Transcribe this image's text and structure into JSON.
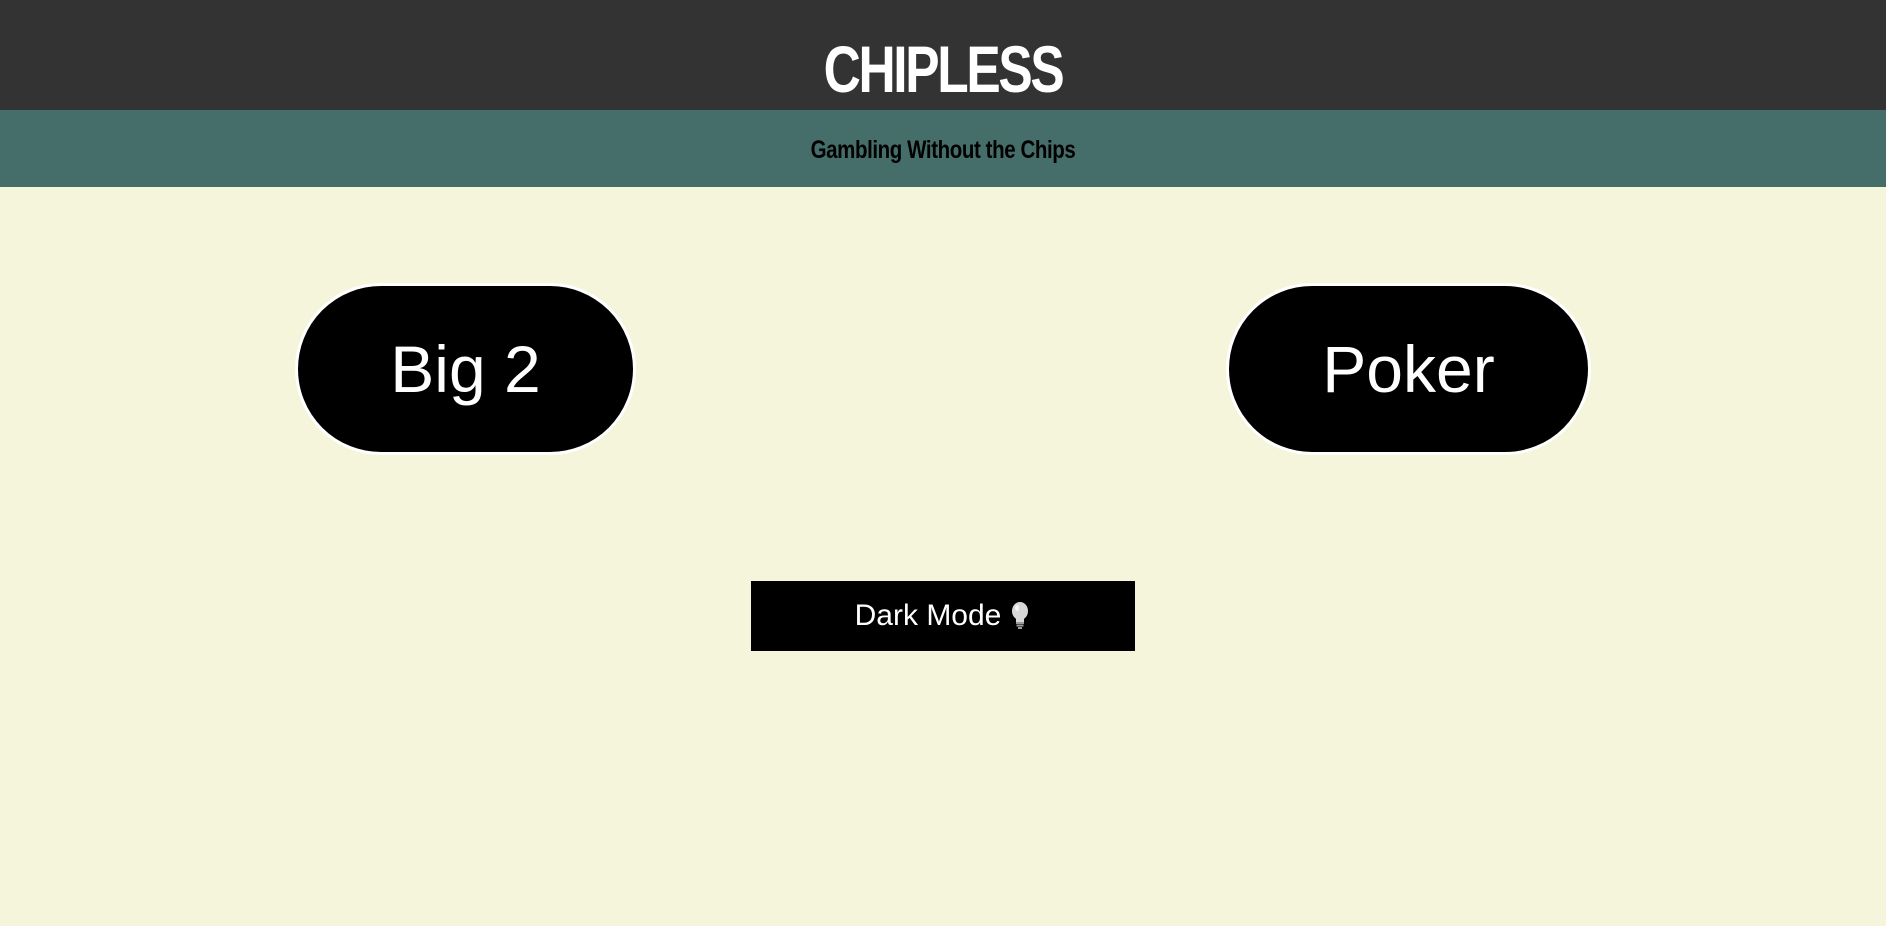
{
  "header": {
    "title": "CHIPLESS",
    "tagline": "Gambling Without the Chips"
  },
  "games": [
    {
      "label": "Big 2"
    },
    {
      "label": "Poker"
    }
  ],
  "theme_toggle": {
    "label": "Dark Mode",
    "icon": "light-bulb-icon"
  },
  "colors": {
    "header_bg": "#333333",
    "subheader_bg": "#456e6a",
    "page_bg": "#f5f5dc",
    "button_bg": "#000000",
    "button_text": "#ffffff"
  }
}
